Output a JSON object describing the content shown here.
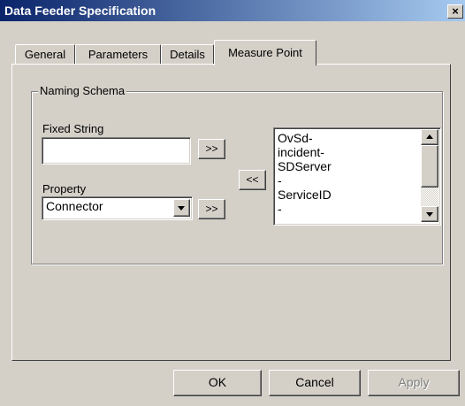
{
  "window": {
    "title": "Data Feeder Specification",
    "close_glyph": "×"
  },
  "tabs": [
    {
      "label": "General",
      "active": false
    },
    {
      "label": "Parameters",
      "active": false
    },
    {
      "label": "Details",
      "active": false
    },
    {
      "label": "Measure Point",
      "active": true
    }
  ],
  "naming_schema": {
    "group_label": "Naming Schema",
    "fixed_string": {
      "label": "Fixed String",
      "value": "",
      "add_label": ">>"
    },
    "property": {
      "label": "Property",
      "selected": "Connector",
      "add_label": ">>"
    },
    "remove_label": "<<",
    "schema_list": {
      "lines": [
        "OvSd-",
        "incident-",
        "SDServer",
        "-",
        "ServiceID",
        "-"
      ]
    }
  },
  "footer": {
    "ok_label": "OK",
    "cancel_label": "Cancel",
    "apply_label": "Apply"
  }
}
